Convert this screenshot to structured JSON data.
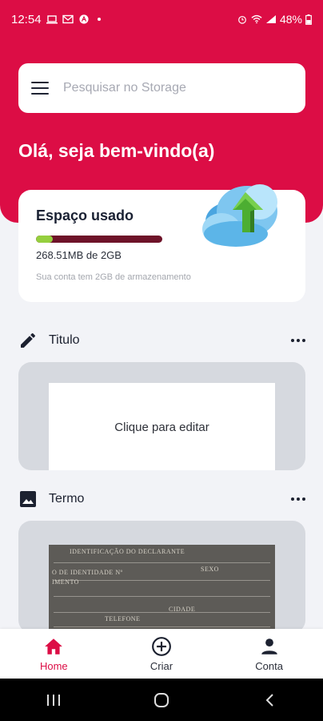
{
  "status_bar": {
    "time": "12:54",
    "battery": "48%"
  },
  "search": {
    "placeholder": "Pesquisar no Storage"
  },
  "greeting": "Olá, seja bem-vindo(a)",
  "storage": {
    "title": "Espaço usado",
    "usage_text": "268.51MB de 2GB",
    "note": "Sua conta tem 2GB de armazenamento",
    "used_fraction": 0.13
  },
  "sections": [
    {
      "label": "Titulo",
      "icon": "pencil-icon",
      "content_text": "Clique para editar"
    },
    {
      "label": "Termo",
      "icon": "image-icon"
    }
  ],
  "bottom_nav": [
    {
      "label": "Home",
      "icon": "home-icon",
      "active": true
    },
    {
      "label": "Criar",
      "icon": "add-circle-icon",
      "active": false
    },
    {
      "label": "Conta",
      "icon": "person-icon",
      "active": false
    }
  ],
  "colors": {
    "brand": "#dc0d45",
    "bar_fill": "#95cf3e",
    "bar_track": "#6e1329"
  }
}
